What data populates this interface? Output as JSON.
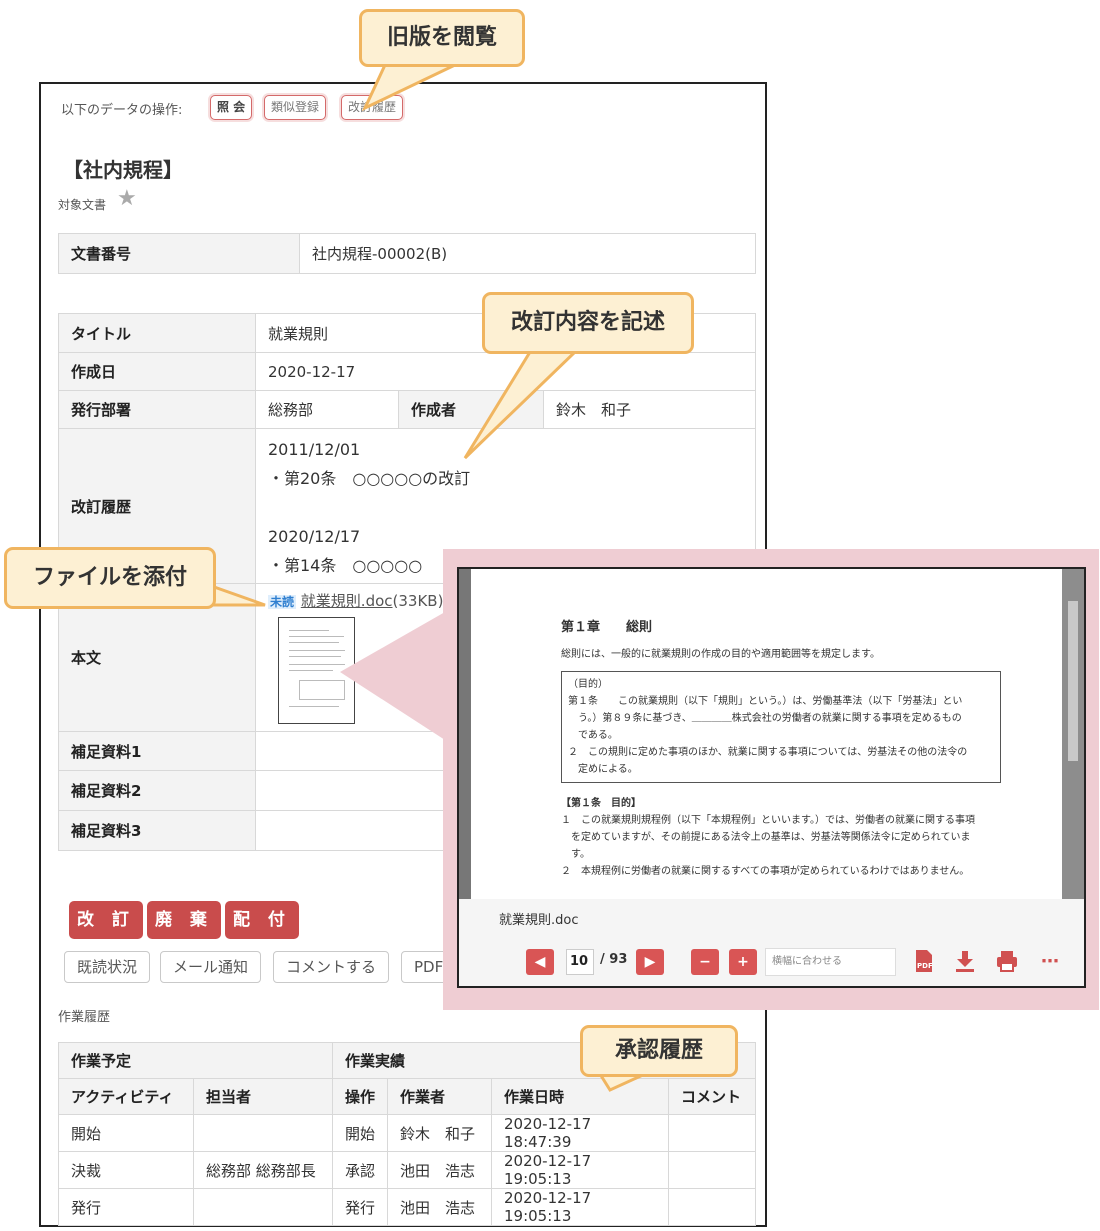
{
  "annotations": {
    "view_old": "旧版を閲覧",
    "describe_revision": "改訂内容を記述",
    "attach_file": "ファイルを添付",
    "approval_history": "承認履歴"
  },
  "ops": {
    "label": "以下のデータの操作:",
    "buttons": [
      "照 会",
      "類似登録",
      "改訂履歴"
    ]
  },
  "page_title": "【社内規程】",
  "doc_target_label": "対象文書",
  "doc_number": {
    "label": "文書番号",
    "value": "社内規程-00002(B)"
  },
  "fields": {
    "title": {
      "label": "タイトル",
      "value": "就業規則"
    },
    "created": {
      "label": "作成日",
      "value": "2020-12-17"
    },
    "department": {
      "label": "発行部署",
      "value": "総務部"
    },
    "author": {
      "label": "作成者",
      "value": "鈴木　和子"
    },
    "revision": {
      "label": "改訂履歴",
      "lines": [
        "2011/12/01",
        "・第20条　○○○○○の改訂",
        "",
        "2020/12/17",
        "・第14条　○○○○○"
      ]
    },
    "body": {
      "label": "本文",
      "badge": "未読",
      "file": "就業規則.doc",
      "size": "(33KB)"
    },
    "supp1": {
      "label": "補足資料1",
      "value": ""
    },
    "supp2": {
      "label": "補足資料2",
      "value": ""
    },
    "supp3": {
      "label": "補足資料3",
      "value": ""
    }
  },
  "actions": [
    "改 訂",
    "廃 棄",
    "配 付"
  ],
  "sub_actions": [
    "既読状況",
    "メール通知",
    "コメントする",
    "PDF"
  ],
  "history": {
    "label": "作業履歴",
    "group_headers": [
      "作業予定",
      "作業実績"
    ],
    "columns": [
      "アクティビティ",
      "担当者",
      "操作",
      "作業者",
      "作業日時",
      "コメント"
    ],
    "rows": [
      [
        "開始",
        "",
        "開始",
        "鈴木　和子",
        "2020-12-17 18:47:39",
        ""
      ],
      [
        "決裁",
        "総務部 総務部長",
        "承認",
        "池田　浩志",
        "2020-12-17 19:05:13",
        ""
      ],
      [
        "発行",
        "",
        "発行",
        "池田　浩志",
        "2020-12-17 19:05:13",
        ""
      ]
    ]
  },
  "viewer": {
    "filename": "就業規則.doc",
    "page": "10",
    "total": "/ 93",
    "zoom_placeholder": "横幅に合わせる",
    "doc": {
      "chapter": "第１章　　総則",
      "intro": "総則には、一般的に就業規則の作成の目的や適用範囲等を規定します。",
      "box_title": "（目的）",
      "box_lines": [
        "第１条　　この就業規則（以下「規則」という。）は、労働基準法（以下「労基法」とい",
        "　う。）第８９条に基づき、＿＿＿＿株式会社の労働者の就業に関する事項を定めるもの",
        "　である。",
        "２　この規則に定めた事項のほか、就業に関する事項については、労基法その他の法令の",
        "　定めによる。"
      ],
      "section": "【第１条　目的】",
      "para_lines": [
        "１　この就業規則規程例（以下「本規程例」といいます。）では、労働者の就業に関する事項",
        "　を定めていますが、その前提にある法令上の基準は、労基法等関係法令に定められていま",
        "　す。",
        "２　本規程例に労働者の就業に関するすべての事項が定められているわけではありません。"
      ]
    }
  }
}
